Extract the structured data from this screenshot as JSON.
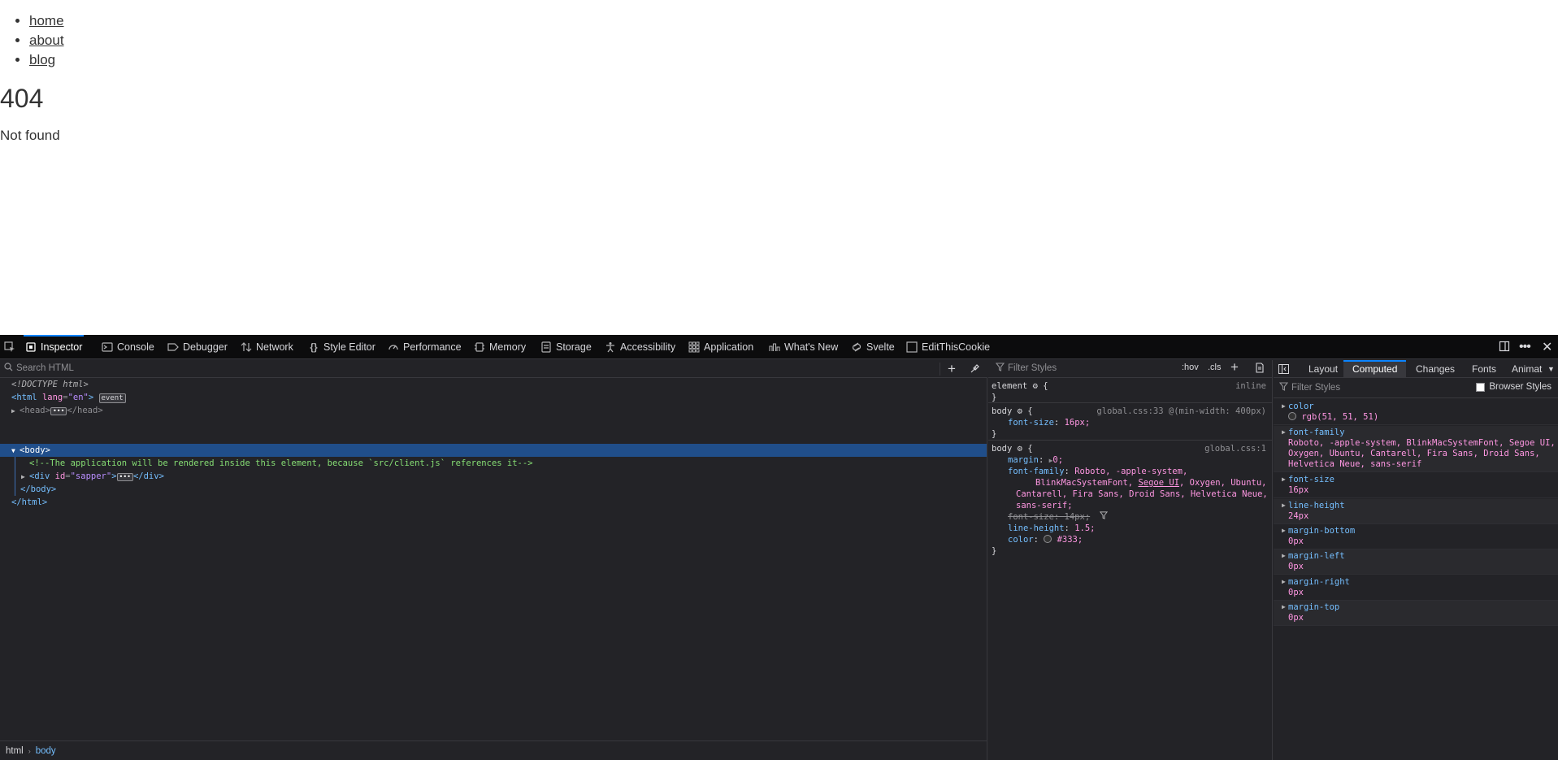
{
  "page": {
    "nav": [
      "home",
      "about",
      "blog"
    ],
    "heading": "404",
    "message": "Not found"
  },
  "toolbar": {
    "tabs": [
      {
        "label": "Inspector",
        "icon": "inspector-icon"
      },
      {
        "label": "Console",
        "icon": "console-icon"
      },
      {
        "label": "Debugger",
        "icon": "debugger-icon"
      },
      {
        "label": "Network",
        "icon": "network-icon"
      },
      {
        "label": "Style Editor",
        "icon": "style-editor-icon"
      },
      {
        "label": "Performance",
        "icon": "performance-icon"
      },
      {
        "label": "Memory",
        "icon": "memory-icon"
      },
      {
        "label": "Storage",
        "icon": "storage-icon"
      },
      {
        "label": "Accessibility",
        "icon": "accessibility-icon"
      },
      {
        "label": "Application",
        "icon": "application-icon"
      },
      {
        "label": "What's New",
        "icon": "whats-new-icon"
      },
      {
        "label": "Svelte",
        "icon": "svelte-icon"
      },
      {
        "label": "EditThisCookie",
        "icon": "cookie-icon"
      }
    ],
    "active_tab": "Inspector"
  },
  "html_panel": {
    "search_placeholder": "Search HTML",
    "doctype": "<!DOCTYPE html>",
    "html_open": "<html",
    "lang_attr": "lang",
    "lang_val": "\"en\"",
    "event_badge": "event",
    "head_open": "<head>",
    "head_close": "</head>",
    "body_open": "<body>",
    "comment": "<!--The application will be rendered inside this element, because `src/client.js` references it-->",
    "div_open": "<div",
    "id_attr": "id",
    "id_val": "\"sapper\"",
    "div_close": "</div>",
    "body_close": "</body>",
    "html_close": "</html>",
    "breadcrumb": [
      "html",
      "body"
    ]
  },
  "rules_panel": {
    "filter_placeholder": "Filter Styles",
    "hov": ":hov",
    "cls": ".cls",
    "rules": {
      "element": {
        "selector": "element",
        "source": "inline"
      },
      "body1": {
        "selector": "body",
        "source": "global.css:33 @(min-width: 400px)",
        "prop": "font-size",
        "val": "16px;"
      },
      "body2": {
        "selector": "body",
        "source": "global.css:1",
        "margin_prop": "margin",
        "margin_val": "0;",
        "ff_prop": "font-family",
        "ff_val_1": "Roboto, -apple-system,",
        "ff_val_2a": "BlinkMacSystemFont, ",
        "ff_val_2b": "Segoe UI",
        "ff_val_2c": ", Oxygen, Ubuntu,",
        "ff_val_3": "Cantarell, Fira Sans, Droid Sans, Helvetica Neue,",
        "ff_val_4": "sans-serif;",
        "fs_struck": "font-size: 14px;",
        "lh_prop": "line-height",
        "lh_val": "1.5;",
        "color_prop": "color",
        "color_val": "#333;"
      }
    }
  },
  "computed_panel": {
    "tabs": [
      "Layout",
      "Computed",
      "Changes",
      "Fonts",
      "Animat"
    ],
    "active_tab": "Computed",
    "filter_placeholder": "Filter Styles",
    "browser_styles": "Browser Styles",
    "props": [
      {
        "name": "color",
        "value": "rgb(51, 51, 51)"
      },
      {
        "name": "font-family",
        "value": "Roboto, -apple-system, BlinkMacSystemFont, Segoe UI,\nOxygen, Ubuntu, Cantarell, Fira Sans, Droid Sans,\nHelvetica Neue, sans-serif"
      },
      {
        "name": "font-size",
        "value": "16px"
      },
      {
        "name": "line-height",
        "value": "24px"
      },
      {
        "name": "margin-bottom",
        "value": "0px"
      },
      {
        "name": "margin-left",
        "value": "0px"
      },
      {
        "name": "margin-right",
        "value": "0px"
      },
      {
        "name": "margin-top",
        "value": "0px"
      }
    ]
  },
  "colors": {
    "devtools_bg": "#232327",
    "toolbar_bg": "#0c0c0d",
    "selection": "#204e8a",
    "accent": "#0a84ff",
    "tag": "#75bfff",
    "attr_name": "#ff97e2",
    "comment": "#86de74"
  }
}
